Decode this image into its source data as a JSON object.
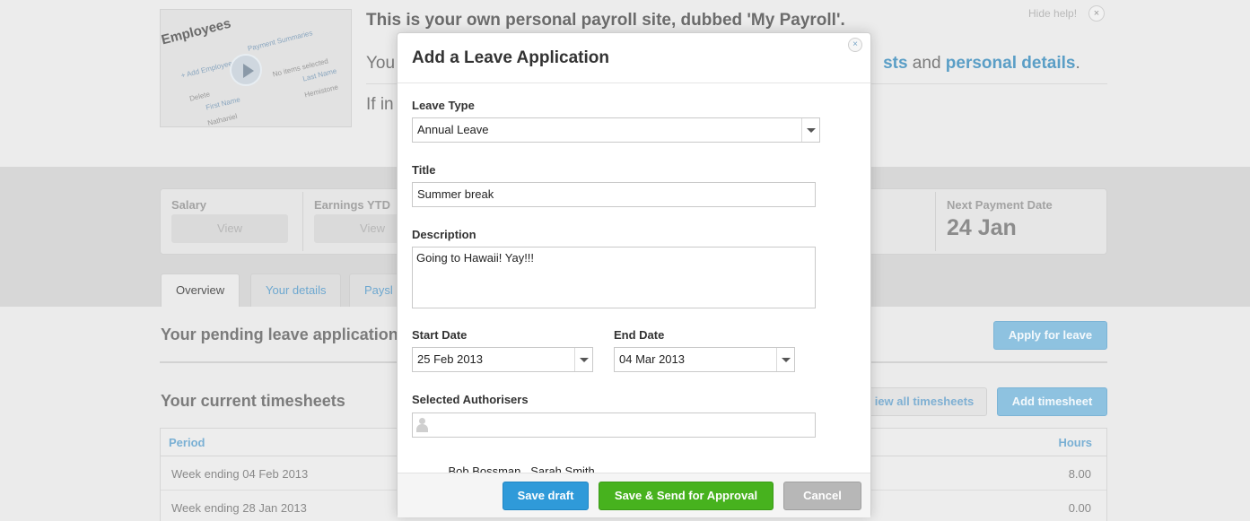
{
  "background": {
    "video": {
      "title": "Employees",
      "labels": [
        "Payment Summaries",
        "+ Add Employee",
        "No items selected",
        "Last Name",
        "Delete",
        "First Name",
        "Nathaniel",
        "Hemistone"
      ]
    },
    "help": {
      "title": "This is your own personal payroll site, dubbed 'My Payroll'.",
      "line2_start": "You",
      "line2_link1": "sts",
      "line2_mid": " and ",
      "line2_link2": "personal details",
      "line2_end": ".",
      "line3_start": "If in",
      "hide_help": "Hide help!",
      "close": "×"
    },
    "summary": {
      "salary_label": "Salary",
      "salary_view": "View",
      "earnings_label": "Earnings YTD",
      "earnings_view": "View",
      "next_payment_label": "Next Payment Date",
      "next_payment_value": "24 Jan"
    },
    "tabs": [
      {
        "label": "Overview"
      },
      {
        "label": "Your details"
      },
      {
        "label": "Paysl"
      }
    ],
    "pending": {
      "title": "Your pending leave application",
      "apply_button": "Apply for leave"
    },
    "timesheets": {
      "title": "Your current timesheets",
      "view_all_button": "iew all timesheets",
      "add_button": "Add timesheet",
      "columns": {
        "period": "Period",
        "hours": "Hours"
      },
      "rows": [
        {
          "period": "Week ending 04 Feb 2013",
          "hours": "8.00"
        },
        {
          "period": "Week ending 28 Jan 2013",
          "hours": "0.00"
        }
      ]
    }
  },
  "modal": {
    "title": "Add a Leave Application",
    "close": "×",
    "leave_type": {
      "label": "Leave Type",
      "value": "Annual Leave"
    },
    "title_field": {
      "label": "Title",
      "value": "Summer break"
    },
    "description": {
      "label": "Description",
      "value": "Going to Hawaii! Yay!!!"
    },
    "start_date": {
      "label": "Start Date",
      "value": "25 Feb 2013"
    },
    "end_date": {
      "label": "End Date",
      "value": "04 Mar 2013"
    },
    "authorisers": {
      "label": "Selected Authorisers",
      "value": "Bob Bossman   Sarah Smith"
    },
    "buttons": {
      "save_draft": "Save draft",
      "save_send": "Save & Send for Approval",
      "cancel": "Cancel"
    }
  },
  "colors": {
    "primary_blue": "#2f9ad9",
    "approve_green": "#47b21e",
    "cancel_grey": "#b7b7b7",
    "link_blue": "#5a9ec6"
  }
}
